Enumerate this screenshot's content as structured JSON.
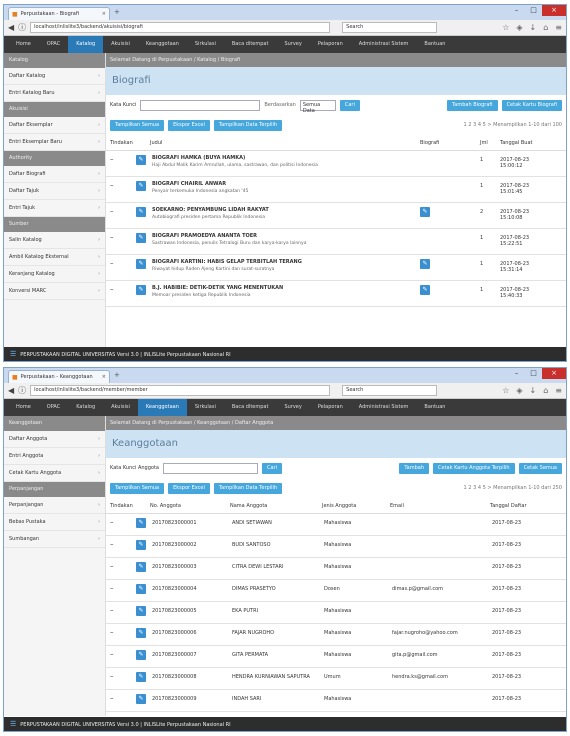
{
  "window1": {
    "tab_title": "Perpustakaan - Biografi",
    "url": "localhost/inlislite3/backend/akuisisi/biografi",
    "search_placeholder": "Search",
    "menu": [
      "Home",
      "OPAC",
      "Katalog",
      "Akuisisi",
      "Keanggotaan",
      "Sirkulasi",
      "Baca ditempat",
      "Survey",
      "Pelaporan",
      "Administrasi Sistem",
      "Bantuan"
    ],
    "menu_active": 2,
    "sidebar": {
      "sections": [
        {
          "header": "Katalog",
          "items": [
            "Daftar Katalog",
            "Entri Katalog Baru"
          ]
        },
        {
          "header": "Akuisisi",
          "items": [
            "Daftar Eksemplar",
            "Entri Eksemplar Baru"
          ]
        },
        {
          "header": "Authority",
          "items": [
            "Daftar Biografi",
            "Daftar Tajuk",
            "Entri Tajuk"
          ]
        },
        {
          "header": "Sumber",
          "items": [
            "Salin Katalog",
            "Ambil Katalog Eksternal",
            "Keranjang Katalog",
            "Konversi MARC"
          ]
        }
      ]
    },
    "breadcrumb": "Selamat Datang di Perpustakaan / Katalog / Biografi",
    "page_title": "Biografi",
    "filter_label": "Kata Kunci",
    "filter_select": "Semua Data",
    "search_button": "Cari",
    "right_buttons": [
      "Tambah Biografi",
      "Cetak Kartu Biografi"
    ],
    "action_buttons": [
      "Tampilkan Semua",
      "Ekspor Excel",
      "Tampilkan Data Terpilih"
    ],
    "pager": "1 2 3 4 5 >  Menampilkan 1-10 dari 100",
    "columns": [
      "Tindakan",
      "Judul",
      "Biografi",
      "Jml",
      "Tanggal Buat"
    ],
    "rows": [
      {
        "title": "BIOGRAFI HAMKA (BUYA HAMKA)",
        "desc": "Haji Abdul Malik Karim Amrullah, ulama, sastrawan, dan politisi Indonesia",
        "has_bio": false,
        "count": "1",
        "date": "2017-08-23 15:00:12"
      },
      {
        "title": "BIOGRAFI CHAIRIL ANWAR",
        "desc": "Penyair terkemuka Indonesia angkatan '45",
        "has_bio": false,
        "count": "1",
        "date": "2017-08-23 15:01:45"
      },
      {
        "title": "SOEKARNO: PENYAMBUNG LIDAH RAKYAT",
        "desc": "Autobiografi presiden pertama Republik Indonesia",
        "has_bio": true,
        "count": "2",
        "date": "2017-08-23 15:10:08"
      },
      {
        "title": "BIOGRAFI PRAMOEDYA ANANTA TOER",
        "desc": "Sastrawan Indonesia, penulis Tetralogi Buru dan karya-karya lainnya",
        "has_bio": false,
        "count": "1",
        "date": "2017-08-23 15:22:51"
      },
      {
        "title": "BIOGRAFI KARTINI: HABIS GELAP TERBITLAH TERANG",
        "desc": "Riwayat hidup Raden Ajeng Kartini dan surat-suratnya",
        "has_bio": true,
        "count": "1",
        "date": "2017-08-23 15:31:14"
      },
      {
        "title": "B.J. HABIBIE: DETIK-DETIK YANG MENENTUKAN",
        "desc": "Memoar presiden ketiga Republik Indonesia",
        "has_bio": true,
        "count": "1",
        "date": "2017-08-23 15:40:33"
      }
    ],
    "status": "PERPUSTAKAAN DIGITAL UNIVERSITAS     Versi 3.0 | INLISLite Perpustakaan Nasional RI"
  },
  "window2": {
    "tab_title": "Perpustakaan - Keanggotaan",
    "url": "localhost/inlislite3/backend/member/member",
    "search_placeholder": "Search",
    "menu": [
      "Home",
      "OPAC",
      "Katalog",
      "Akuisisi",
      "Keanggotaan",
      "Sirkulasi",
      "Baca ditempat",
      "Survey",
      "Pelaporan",
      "Administrasi Sistem",
      "Bantuan"
    ],
    "menu_active": 4,
    "sidebar": {
      "sections": [
        {
          "header": "Keanggotaan",
          "items": [
            "Daftar Anggota",
            "Entri Anggota",
            "Cetak Kartu Anggota"
          ]
        },
        {
          "header": "Perpanjangan",
          "items": [
            "Perpanjangan",
            "Bebas Pustaka",
            "Sumbangan"
          ]
        }
      ]
    },
    "breadcrumb": "Selamat Datang di Perpustakaan / Keanggotaan / Daftar Anggota",
    "page_title": "Keanggotaan",
    "filter_label": "Kata Kunci Anggota",
    "search_button": "Cari",
    "right_buttons": [
      "Tambah",
      "Cetak Kartu Anggota Terpilih",
      "Cetak Semua"
    ],
    "action_buttons": [
      "Tampilkan Semua",
      "Ekspor Excel",
      "Tampilkan Data Terpilih"
    ],
    "pager": "1 2 3 4 5 >  Menampilkan 1-10 dari 250",
    "columns": [
      "Tindakan",
      "No. Anggota",
      "Nama Anggota",
      "Jenis Anggota",
      "Email",
      "Tanggal Daftar"
    ],
    "rows": [
      {
        "no": "20170823000001",
        "name": "ANDI SETIAWAN",
        "type": "Mahasiswa",
        "email": "",
        "date": "2017-08-23"
      },
      {
        "no": "20170823000002",
        "name": "BUDI SANTOSO",
        "type": "Mahasiswa",
        "email": "",
        "date": "2017-08-23"
      },
      {
        "no": "20170823000003",
        "name": "CITRA DEWI LESTARI",
        "type": "Mahasiswa",
        "email": "",
        "date": "2017-08-23"
      },
      {
        "no": "20170823000004",
        "name": "DIMAS PRASETYO",
        "type": "Dosen",
        "email": "dimas.p@gmail.com",
        "date": "2017-08-23"
      },
      {
        "no": "20170823000005",
        "name": "EKA PUTRI",
        "type": "Mahasiswa",
        "email": "",
        "date": "2017-08-23"
      },
      {
        "no": "20170823000006",
        "name": "FAJAR NUGROHO",
        "type": "Mahasiswa",
        "email": "fajar.nugroho@yahoo.com",
        "date": "2017-08-23"
      },
      {
        "no": "20170823000007",
        "name": "GITA PERMATA",
        "type": "Mahasiswa",
        "email": "gita.p@gmail.com",
        "date": "2017-08-23"
      },
      {
        "no": "20170823000008",
        "name": "HENDRA KURNIAWAN SAPUTRA",
        "type": "Umum",
        "email": "hendra.ks@gmail.com",
        "date": "2017-08-23"
      },
      {
        "no": "20170823000009",
        "name": "INDAH SARI",
        "type": "Mahasiswa",
        "email": "",
        "date": "2017-08-23"
      }
    ],
    "status": "PERPUSTAKAAN DIGITAL UNIVERSITAS     Versi 3.0 | INLISLite Perpustakaan Nasional RI"
  }
}
